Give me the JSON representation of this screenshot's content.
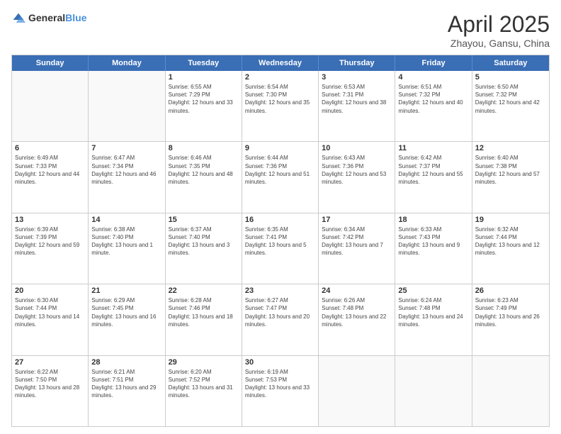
{
  "logo": {
    "general": "General",
    "blue": "Blue"
  },
  "title": "April 2025",
  "subtitle": "Zhayou, Gansu, China",
  "header_days": [
    "Sunday",
    "Monday",
    "Tuesday",
    "Wednesday",
    "Thursday",
    "Friday",
    "Saturday"
  ],
  "weeks": [
    [
      {
        "day": "",
        "info": ""
      },
      {
        "day": "",
        "info": ""
      },
      {
        "day": "1",
        "info": "Sunrise: 6:55 AM\nSunset: 7:29 PM\nDaylight: 12 hours and 33 minutes."
      },
      {
        "day": "2",
        "info": "Sunrise: 6:54 AM\nSunset: 7:30 PM\nDaylight: 12 hours and 35 minutes."
      },
      {
        "day": "3",
        "info": "Sunrise: 6:53 AM\nSunset: 7:31 PM\nDaylight: 12 hours and 38 minutes."
      },
      {
        "day": "4",
        "info": "Sunrise: 6:51 AM\nSunset: 7:32 PM\nDaylight: 12 hours and 40 minutes."
      },
      {
        "day": "5",
        "info": "Sunrise: 6:50 AM\nSunset: 7:32 PM\nDaylight: 12 hours and 42 minutes."
      }
    ],
    [
      {
        "day": "6",
        "info": "Sunrise: 6:49 AM\nSunset: 7:33 PM\nDaylight: 12 hours and 44 minutes."
      },
      {
        "day": "7",
        "info": "Sunrise: 6:47 AM\nSunset: 7:34 PM\nDaylight: 12 hours and 46 minutes."
      },
      {
        "day": "8",
        "info": "Sunrise: 6:46 AM\nSunset: 7:35 PM\nDaylight: 12 hours and 48 minutes."
      },
      {
        "day": "9",
        "info": "Sunrise: 6:44 AM\nSunset: 7:36 PM\nDaylight: 12 hours and 51 minutes."
      },
      {
        "day": "10",
        "info": "Sunrise: 6:43 AM\nSunset: 7:36 PM\nDaylight: 12 hours and 53 minutes."
      },
      {
        "day": "11",
        "info": "Sunrise: 6:42 AM\nSunset: 7:37 PM\nDaylight: 12 hours and 55 minutes."
      },
      {
        "day": "12",
        "info": "Sunrise: 6:40 AM\nSunset: 7:38 PM\nDaylight: 12 hours and 57 minutes."
      }
    ],
    [
      {
        "day": "13",
        "info": "Sunrise: 6:39 AM\nSunset: 7:39 PM\nDaylight: 12 hours and 59 minutes."
      },
      {
        "day": "14",
        "info": "Sunrise: 6:38 AM\nSunset: 7:40 PM\nDaylight: 13 hours and 1 minute."
      },
      {
        "day": "15",
        "info": "Sunrise: 6:37 AM\nSunset: 7:40 PM\nDaylight: 13 hours and 3 minutes."
      },
      {
        "day": "16",
        "info": "Sunrise: 6:35 AM\nSunset: 7:41 PM\nDaylight: 13 hours and 5 minutes."
      },
      {
        "day": "17",
        "info": "Sunrise: 6:34 AM\nSunset: 7:42 PM\nDaylight: 13 hours and 7 minutes."
      },
      {
        "day": "18",
        "info": "Sunrise: 6:33 AM\nSunset: 7:43 PM\nDaylight: 13 hours and 9 minutes."
      },
      {
        "day": "19",
        "info": "Sunrise: 6:32 AM\nSunset: 7:44 PM\nDaylight: 13 hours and 12 minutes."
      }
    ],
    [
      {
        "day": "20",
        "info": "Sunrise: 6:30 AM\nSunset: 7:44 PM\nDaylight: 13 hours and 14 minutes."
      },
      {
        "day": "21",
        "info": "Sunrise: 6:29 AM\nSunset: 7:45 PM\nDaylight: 13 hours and 16 minutes."
      },
      {
        "day": "22",
        "info": "Sunrise: 6:28 AM\nSunset: 7:46 PM\nDaylight: 13 hours and 18 minutes."
      },
      {
        "day": "23",
        "info": "Sunrise: 6:27 AM\nSunset: 7:47 PM\nDaylight: 13 hours and 20 minutes."
      },
      {
        "day": "24",
        "info": "Sunrise: 6:26 AM\nSunset: 7:48 PM\nDaylight: 13 hours and 22 minutes."
      },
      {
        "day": "25",
        "info": "Sunrise: 6:24 AM\nSunset: 7:48 PM\nDaylight: 13 hours and 24 minutes."
      },
      {
        "day": "26",
        "info": "Sunrise: 6:23 AM\nSunset: 7:49 PM\nDaylight: 13 hours and 26 minutes."
      }
    ],
    [
      {
        "day": "27",
        "info": "Sunrise: 6:22 AM\nSunset: 7:50 PM\nDaylight: 13 hours and 28 minutes."
      },
      {
        "day": "28",
        "info": "Sunrise: 6:21 AM\nSunset: 7:51 PM\nDaylight: 13 hours and 29 minutes."
      },
      {
        "day": "29",
        "info": "Sunrise: 6:20 AM\nSunset: 7:52 PM\nDaylight: 13 hours and 31 minutes."
      },
      {
        "day": "30",
        "info": "Sunrise: 6:19 AM\nSunset: 7:53 PM\nDaylight: 13 hours and 33 minutes."
      },
      {
        "day": "",
        "info": ""
      },
      {
        "day": "",
        "info": ""
      },
      {
        "day": "",
        "info": ""
      }
    ]
  ]
}
